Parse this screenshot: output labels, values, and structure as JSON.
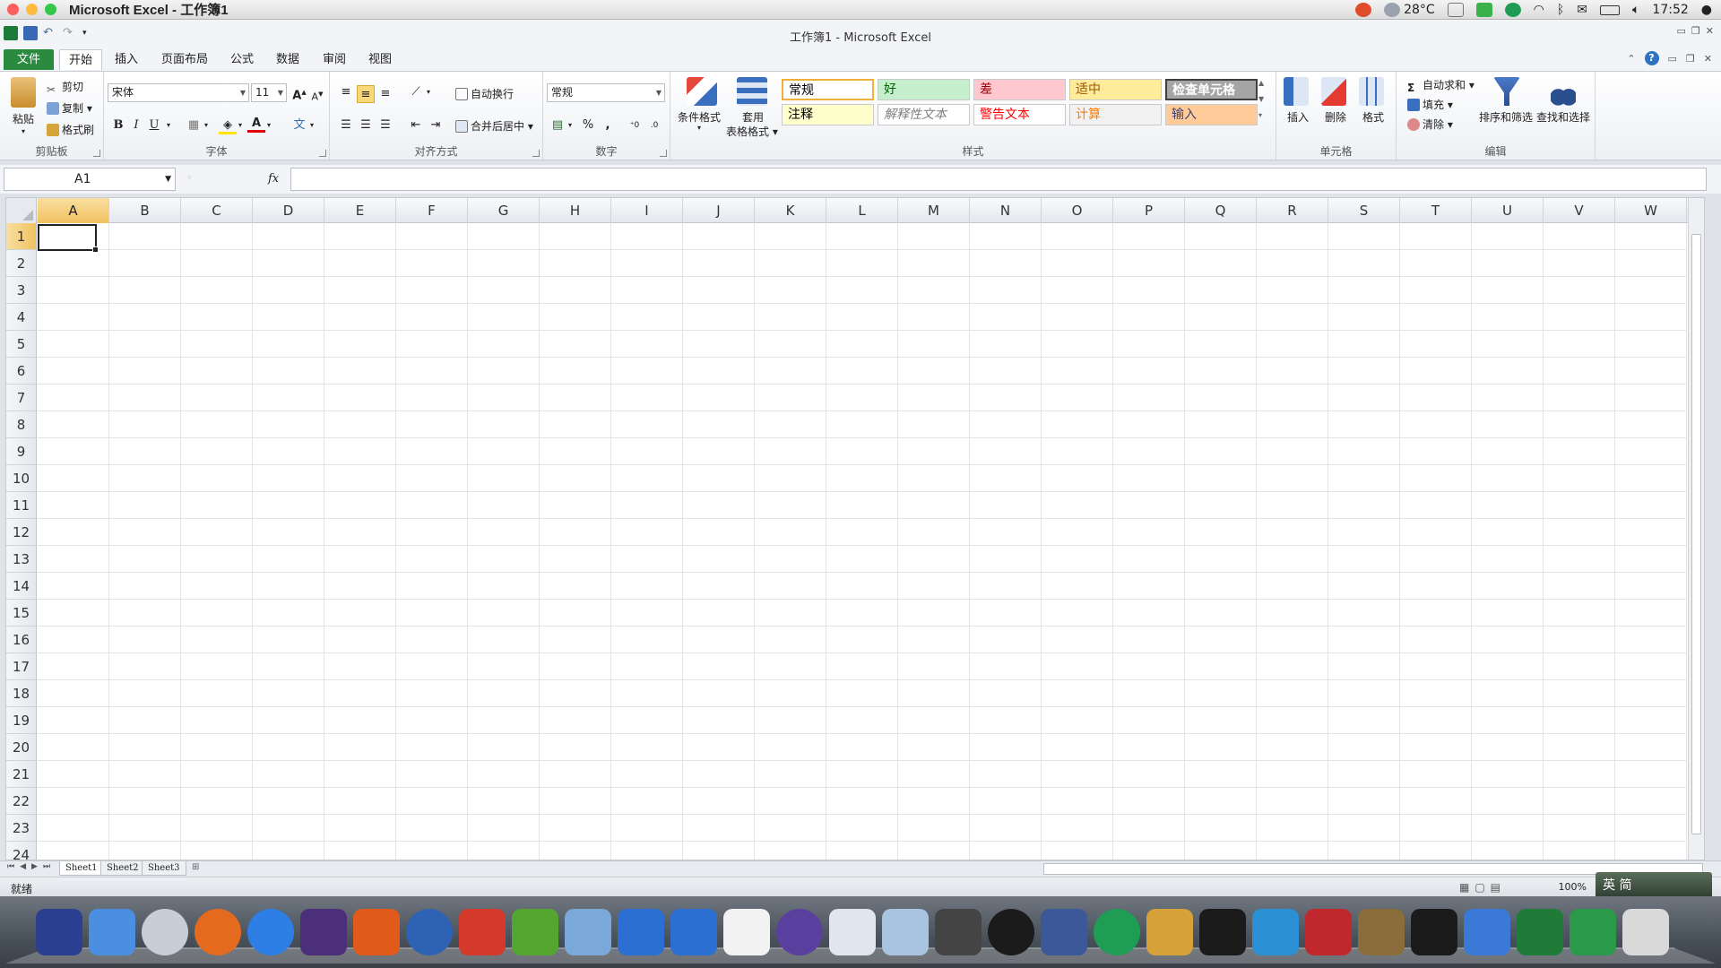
{
  "menubar": {
    "app_title": "Microsoft Excel - 工作簿1",
    "weather": "28°C",
    "clock": "17:52"
  },
  "window": {
    "title": "工作簿1 - Microsoft Excel"
  },
  "tabs": {
    "file": "文件",
    "home": "开始",
    "insert": "插入",
    "layout": "页面布局",
    "formulas": "公式",
    "data": "数据",
    "review": "审阅",
    "view": "视图"
  },
  "clipboard": {
    "paste": "粘贴",
    "cut": "剪切",
    "copy": "复制",
    "format_painter": "格式刷",
    "label": "剪贴板"
  },
  "font": {
    "name": "宋体",
    "size": "11",
    "bold": "B",
    "italic": "I",
    "underline": "U",
    "grow": "A",
    "shrink": "A",
    "label": "字体"
  },
  "alignment": {
    "wrap_text": "自动换行",
    "merge_center": "合并后居中",
    "label": "对齐方式"
  },
  "number": {
    "format": "常规",
    "percent": "%",
    "comma": ",",
    "label": "数字"
  },
  "styles": {
    "conditional": "条件格式",
    "table_style_1": "套用",
    "table_style_2": "表格格式",
    "cells": [
      {
        "label": "常规",
        "bg": "#ffffff",
        "fg": "#000000"
      },
      {
        "label": "好",
        "bg": "#c6efce",
        "fg": "#006100"
      },
      {
        "label": "差",
        "bg": "#ffc7ce",
        "fg": "#9c0006"
      },
      {
        "label": "适中",
        "bg": "#ffeb9c",
        "fg": "#9c5700"
      },
      {
        "label": "检查单元格",
        "bg": "#a5a5a5",
        "fg": "#ffffff"
      },
      {
        "label": "注释",
        "bg": "#ffffcc",
        "fg": "#000000"
      },
      {
        "label": "解释性文本",
        "bg": "#ffffff",
        "fg": "#7f7f7f"
      },
      {
        "label": "警告文本",
        "bg": "#ffffff",
        "fg": "#ff0000"
      },
      {
        "label": "计算",
        "bg": "#f2f2f2",
        "fg": "#fa7d00"
      },
      {
        "label": "输入",
        "bg": "#ffcc99",
        "fg": "#3f3f76"
      }
    ],
    "label": "样式"
  },
  "cells_group": {
    "insert": "插入",
    "delete": "删除",
    "format": "格式",
    "label": "单元格"
  },
  "editing": {
    "autosum": "自动求和",
    "fill": "填充",
    "clear": "清除",
    "sort_filter": "排序和筛选",
    "find_select": "查找和选择",
    "label": "编辑"
  },
  "formula_bar": {
    "name_box": "A1",
    "fx": "fx"
  },
  "grid": {
    "columns": [
      "A",
      "B",
      "C",
      "D",
      "E",
      "F",
      "G",
      "H",
      "I",
      "J",
      "K",
      "L",
      "M",
      "N",
      "O",
      "P",
      "Q",
      "R",
      "S",
      "T",
      "U",
      "V",
      "W"
    ],
    "rows": [
      "1",
      "2",
      "3",
      "4",
      "5",
      "6",
      "7",
      "8",
      "9",
      "10",
      "11",
      "12",
      "13",
      "14",
      "15",
      "16",
      "17",
      "18",
      "19",
      "20",
      "21",
      "22",
      "23",
      "24"
    ]
  },
  "sheets": [
    "Sheet1",
    "Sheet2",
    "Sheet3"
  ],
  "status": {
    "ready": "就绪",
    "zoom": "100%",
    "ime": "英 简"
  }
}
